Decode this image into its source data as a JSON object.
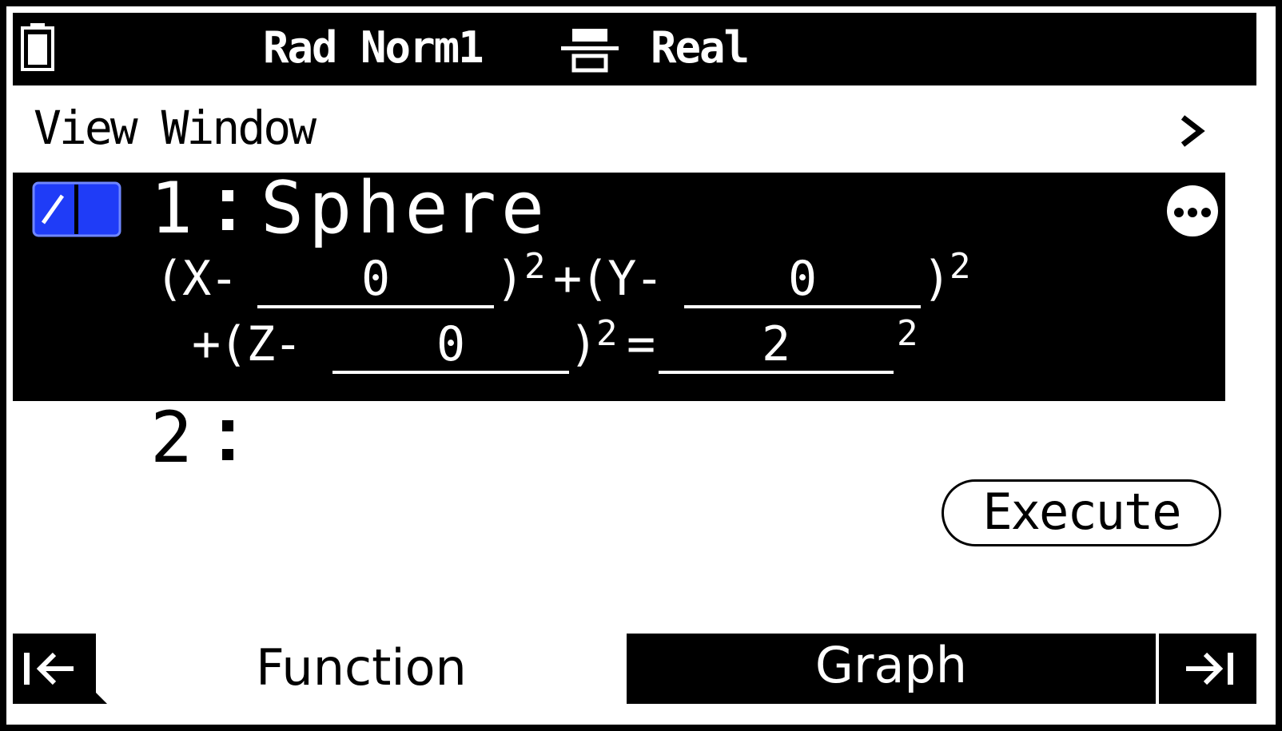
{
  "status_bar": {
    "angle_mode": "Rad Norm1",
    "complex_mode": "Real",
    "battery_icon": "battery-icon",
    "display_icon": "input-output-icon"
  },
  "view_window": {
    "label": "View Window",
    "chevron_icon": "chevron-right-icon"
  },
  "functions": [
    {
      "number": "1",
      "name": "Sphere",
      "toggle_icon": "graph-toggle-icon",
      "more_icon": "more-options-icon",
      "equation": {
        "x_prefix": "(X-",
        "x_center": "0",
        "x_suffix": ")",
        "exp": "2",
        "y_prefix": "+(Y-",
        "y_center": "0",
        "y_suffix": ")",
        "z_prefix": "+(Z-",
        "z_center": "0",
        "z_suffix": ")",
        "equals": "=",
        "radius": "2"
      }
    },
    {
      "number": "2",
      "name": ""
    }
  ],
  "buttons": {
    "execute": "Execute"
  },
  "tabs": {
    "function": "Function",
    "graph": "Graph",
    "first_icon": "arrow-to-start-icon",
    "last_icon": "arrow-to-end-icon"
  },
  "colors": {
    "accent": "#1f3cf7",
    "foreground": "#000000",
    "background": "#ffffff"
  }
}
